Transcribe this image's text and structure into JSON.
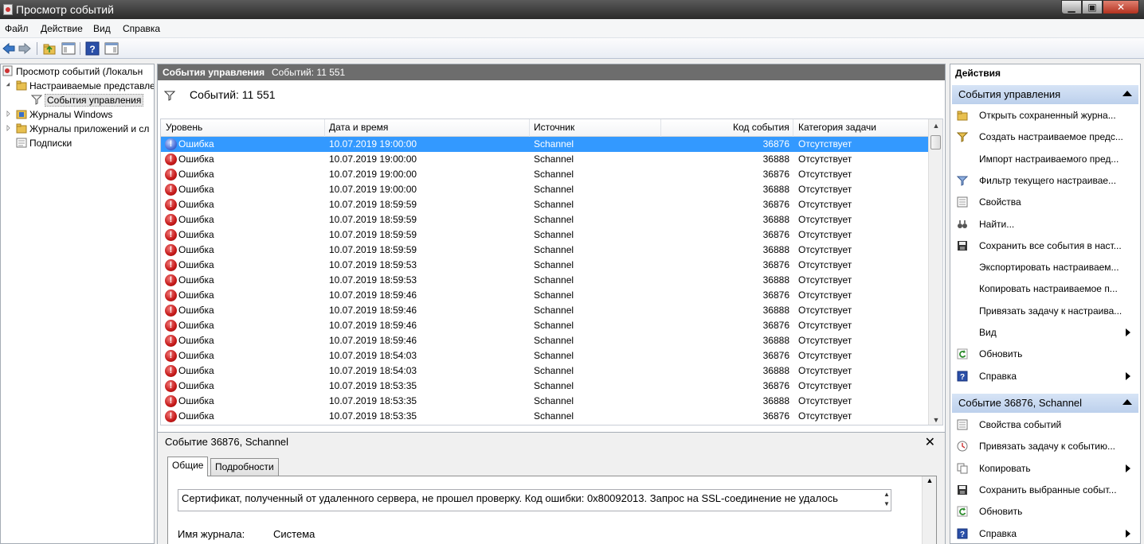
{
  "window": {
    "title": "Просмотр событий"
  },
  "menu": [
    "Файл",
    "Действие",
    "Вид",
    "Справка"
  ],
  "tree": {
    "root": "Просмотр событий (Локальн",
    "custom_views": "Настраиваемые представле",
    "selected": "События управления",
    "windows_logs": "Журналы Windows",
    "app_logs": "Журналы приложений и сл",
    "subscriptions": "Подписки"
  },
  "center": {
    "header_title": "События управления",
    "header_count": "Событий: 11 551",
    "filter_count": "Событий: 11 551",
    "columns": [
      "Уровень",
      "Дата и время",
      "Источник",
      "Код события",
      "Категория задачи"
    ],
    "rows": [
      [
        "Ошибка",
        "10.07.2019 19:00:00",
        "Schannel",
        "36876",
        "Отсутствует"
      ],
      [
        "Ошибка",
        "10.07.2019 19:00:00",
        "Schannel",
        "36888",
        "Отсутствует"
      ],
      [
        "Ошибка",
        "10.07.2019 19:00:00",
        "Schannel",
        "36876",
        "Отсутствует"
      ],
      [
        "Ошибка",
        "10.07.2019 19:00:00",
        "Schannel",
        "36888",
        "Отсутствует"
      ],
      [
        "Ошибка",
        "10.07.2019 18:59:59",
        "Schannel",
        "36876",
        "Отсутствует"
      ],
      [
        "Ошибка",
        "10.07.2019 18:59:59",
        "Schannel",
        "36888",
        "Отсутствует"
      ],
      [
        "Ошибка",
        "10.07.2019 18:59:59",
        "Schannel",
        "36876",
        "Отсутствует"
      ],
      [
        "Ошибка",
        "10.07.2019 18:59:59",
        "Schannel",
        "36888",
        "Отсутствует"
      ],
      [
        "Ошибка",
        "10.07.2019 18:59:53",
        "Schannel",
        "36876",
        "Отсутствует"
      ],
      [
        "Ошибка",
        "10.07.2019 18:59:53",
        "Schannel",
        "36888",
        "Отсутствует"
      ],
      [
        "Ошибка",
        "10.07.2019 18:59:46",
        "Schannel",
        "36876",
        "Отсутствует"
      ],
      [
        "Ошибка",
        "10.07.2019 18:59:46",
        "Schannel",
        "36888",
        "Отсутствует"
      ],
      [
        "Ошибка",
        "10.07.2019 18:59:46",
        "Schannel",
        "36876",
        "Отсутствует"
      ],
      [
        "Ошибка",
        "10.07.2019 18:59:46",
        "Schannel",
        "36888",
        "Отсутствует"
      ],
      [
        "Ошибка",
        "10.07.2019 18:54:03",
        "Schannel",
        "36876",
        "Отсутствует"
      ],
      [
        "Ошибка",
        "10.07.2019 18:54:03",
        "Schannel",
        "36888",
        "Отсутствует"
      ],
      [
        "Ошибка",
        "10.07.2019 18:53:35",
        "Schannel",
        "36876",
        "Отсутствует"
      ],
      [
        "Ошибка",
        "10.07.2019 18:53:35",
        "Schannel",
        "36888",
        "Отсутствует"
      ],
      [
        "Ошибка",
        "10.07.2019 18:53:35",
        "Schannel",
        "36876",
        "Отсутствует"
      ]
    ],
    "selected_row": 0
  },
  "detail": {
    "title": "Событие 36876, Schannel",
    "tabs": [
      "Общие",
      "Подробности"
    ],
    "description": "Сертификат, полученный от удаленного сервера, не прошел проверку. Код ошибки: 0x80092013. Запрос на SSL-соединение не удалось",
    "log_label": "Имя журнала:",
    "log_value": "Система"
  },
  "actions": {
    "title": "Действия",
    "section1": {
      "title": "События управления",
      "items": [
        {
          "label": "Открыть сохраненный журна...",
          "icon": "folder-open-icon"
        },
        {
          "label": "Создать настраиваемое предс...",
          "icon": "filter-new-icon"
        },
        {
          "label": "Импорт настраиваемого пред...",
          "icon": ""
        },
        {
          "label": "Фильтр текущего настраивае...",
          "icon": "filter-icon"
        },
        {
          "label": "Свойства",
          "icon": "properties-icon"
        },
        {
          "label": "Найти...",
          "icon": "binoculars-icon"
        },
        {
          "label": "Сохранить все события в наст...",
          "icon": "save-icon"
        },
        {
          "label": "Экспортировать настраиваем...",
          "icon": ""
        },
        {
          "label": "Копировать настраиваемое п...",
          "icon": ""
        },
        {
          "label": "Привязать задачу к настраива...",
          "icon": ""
        },
        {
          "label": "Вид",
          "icon": "",
          "submenu": true
        },
        {
          "label": "Обновить",
          "icon": "refresh-icon"
        },
        {
          "label": "Справка",
          "icon": "help-icon",
          "submenu": true
        }
      ]
    },
    "section2": {
      "title": "Событие 36876, Schannel",
      "items": [
        {
          "label": "Свойства событий",
          "icon": "properties-icon"
        },
        {
          "label": "Привязать задачу к событию...",
          "icon": "task-icon"
        },
        {
          "label": "Копировать",
          "icon": "copy-icon",
          "submenu": true
        },
        {
          "label": "Сохранить выбранные событ...",
          "icon": "save-icon"
        },
        {
          "label": "Обновить",
          "icon": "refresh-icon"
        },
        {
          "label": "Справка",
          "icon": "help-icon",
          "submenu": true
        }
      ]
    }
  },
  "colors": {
    "selection": "#3399ff",
    "error": "#c41818",
    "section_header": "#c9daf0"
  }
}
